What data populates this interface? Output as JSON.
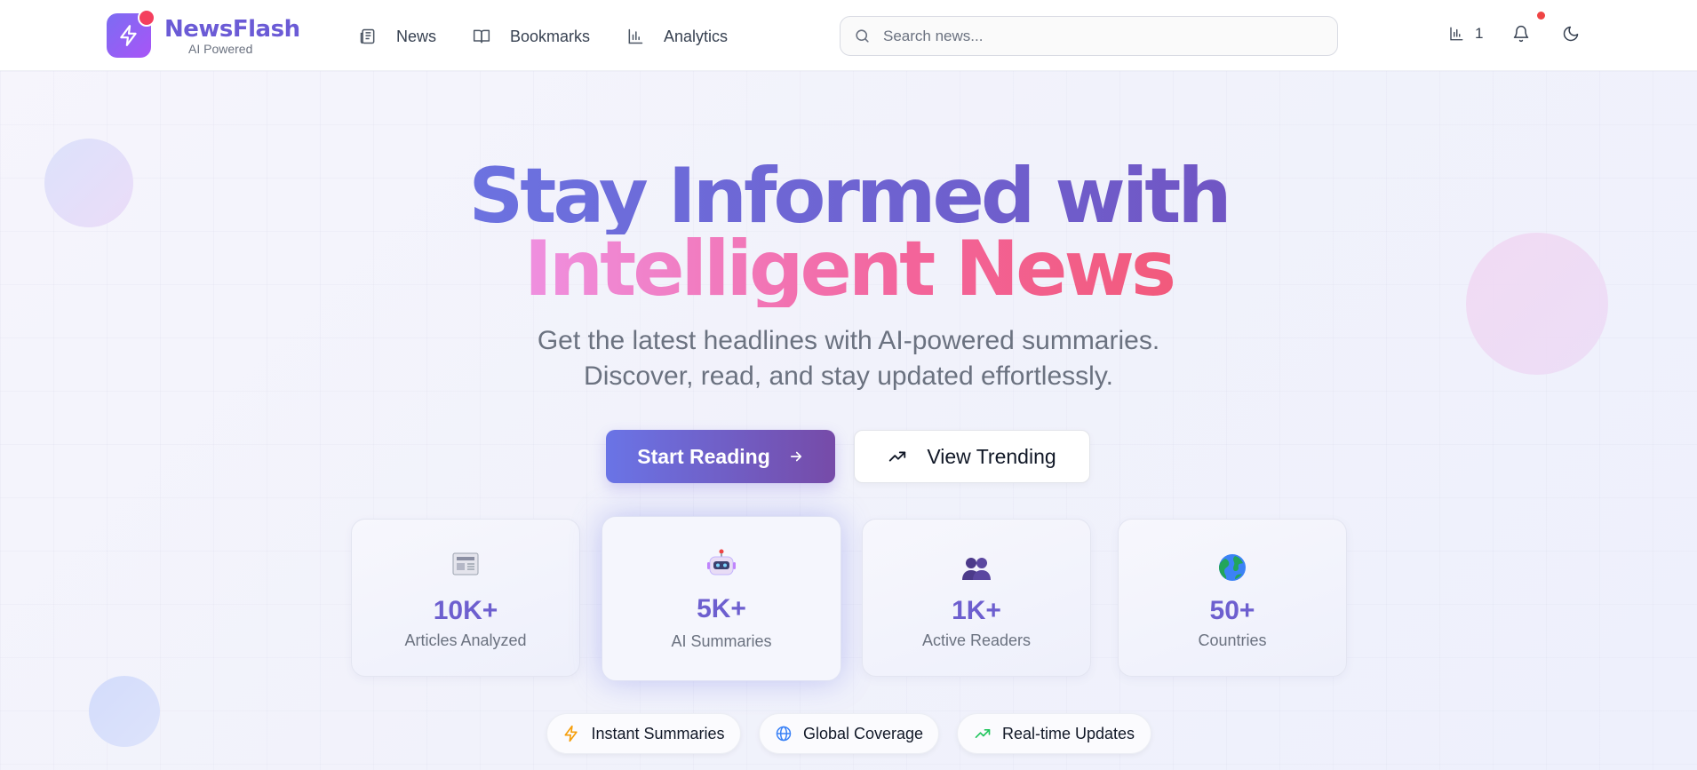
{
  "header": {
    "brand": {
      "name": "NewsFlash",
      "tagline": "AI Powered"
    },
    "nav": [
      {
        "label": "News",
        "icon": "newspaper-icon"
      },
      {
        "label": "Bookmarks",
        "icon": "book-open-icon"
      },
      {
        "label": "Analytics",
        "icon": "bar-chart-icon"
      }
    ],
    "search": {
      "placeholder": "Search news...",
      "value": ""
    },
    "analytics_count": "1"
  },
  "hero": {
    "line1": "Stay Informed with",
    "line2": "Intelligent News",
    "subtitle_line1": "Get the latest headlines with AI-powered summaries.",
    "subtitle_line2": "Discover, read, and stay updated effortlessly.",
    "primary_button": "Start Reading",
    "secondary_button": "View Trending"
  },
  "stats": [
    {
      "emoji": "newspaper",
      "value": "10K+",
      "label": "Articles Analyzed"
    },
    {
      "emoji": "robot",
      "value": "5K+",
      "label": "AI Summaries"
    },
    {
      "emoji": "people",
      "value": "1K+",
      "label": "Active Readers"
    },
    {
      "emoji": "globe",
      "value": "50+",
      "label": "Countries"
    }
  ],
  "features": [
    {
      "label": "Instant Summaries",
      "icon": "zap-icon",
      "color": "#f59e0b"
    },
    {
      "label": "Global Coverage",
      "icon": "globe-icon",
      "color": "#3b82f6"
    },
    {
      "label": "Real-time Updates",
      "icon": "trending-up-icon",
      "color": "#22c55e"
    }
  ],
  "colors": {
    "brand": "#6b5bd6",
    "accent_gradient_start": "#6a74e6",
    "accent_gradient_end": "#764ba8",
    "notification": "#ef4444"
  }
}
